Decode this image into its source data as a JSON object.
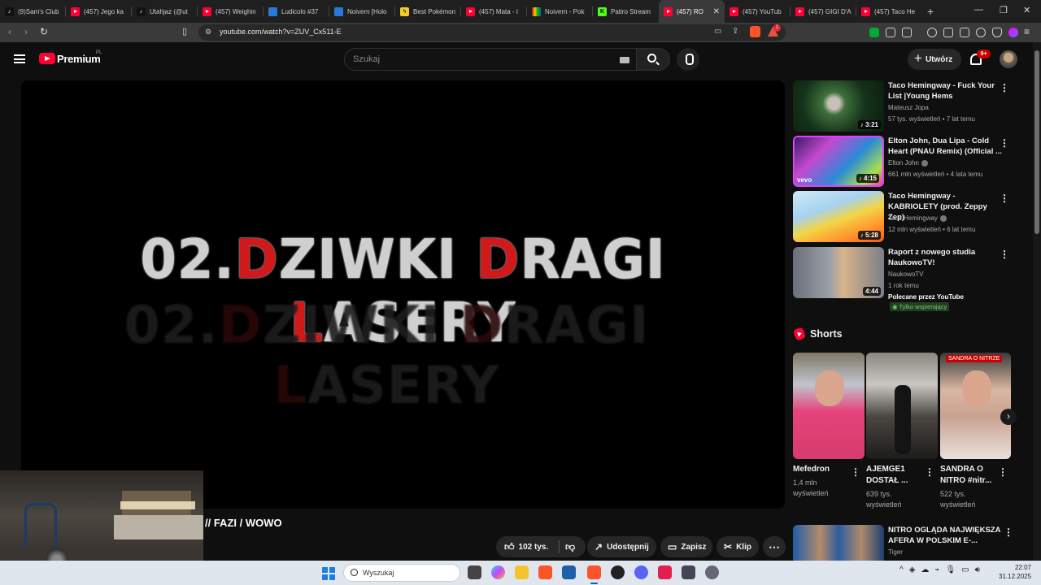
{
  "browser": {
    "tabs": [
      {
        "label": "(9)Sam's Club",
        "icon": "tiktok"
      },
      {
        "label": "(457) Jego ka",
        "icon": "youtube"
      },
      {
        "label": "Utahjaz (@ut",
        "icon": "tiktok"
      },
      {
        "label": "(457) Weighin",
        "icon": "youtube"
      },
      {
        "label": "Ludicolo #37",
        "icon": "pokemon"
      },
      {
        "label": "Noivern [Holo",
        "icon": "blue"
      },
      {
        "label": "Best Pokémon",
        "icon": "pikachu"
      },
      {
        "label": "(457) Mata - I",
        "icon": "youtube"
      },
      {
        "label": "Noivern - Pok",
        "icon": "multicolor"
      },
      {
        "label": "Patiro Stream",
        "icon": "kick"
      },
      {
        "label": "(457) RO",
        "icon": "youtube",
        "active": true
      },
      {
        "label": "(457) YouTub",
        "icon": "youtube"
      },
      {
        "label": "(457) GIGI D'A",
        "icon": "youtube"
      },
      {
        "label": "(457) Taco He",
        "icon": "youtube"
      }
    ],
    "url": "youtube.com/watch?v=ZUV_Cx511-E",
    "extension_badge": "1"
  },
  "youtube": {
    "logo_text": "Premium",
    "logo_country": "PL",
    "search_placeholder": "Szukaj",
    "create_label": "Utwórz",
    "notifications_badge": "9+",
    "video": {
      "frame_text_parts": [
        "02.",
        "D",
        "ZIWKI ",
        "D",
        "RAGI ",
        "L",
        "ASERY"
      ],
      "title": "// FAZI / WOWO",
      "likes": "102 tys.",
      "share_label": "Udostępnij",
      "save_label": "Zapisz",
      "clip_label": "Klip"
    },
    "recommendations": [
      {
        "title": "Taco Hemingway - Fuck Your List |Young Hems",
        "channel": "Mateusz Jopa",
        "verified": false,
        "meta": "57 tys. wyświetleń • 7 lat temu",
        "duration": "3:21"
      },
      {
        "title": "Elton John, Dua Lipa - Cold Heart (PNAU Remix) (Official ...",
        "channel": "Elton John",
        "verified": true,
        "meta": "661 mln wyświetleń • 4 lata temu",
        "duration": "4:15",
        "thumb_label": "vevo"
      },
      {
        "title": "Taco Hemingway - KABRIOLETY (prod. Zeppy Zep)",
        "channel": "Taco Hemingway",
        "verified": true,
        "meta": "12 mln wyświetleń • 6 lat temu",
        "duration": "5:28"
      },
      {
        "title": "Raport z nowego studia NaukowoTV!",
        "channel": "NaukowoTV",
        "verified": false,
        "meta": "1 rok temu",
        "duration": "4:44",
        "recommended": "Polecane przez YouTube",
        "members": "Tylko wspierający"
      }
    ],
    "shorts_label": "Shorts",
    "shorts": [
      {
        "title": "Mefedron",
        "views": "1,4 mln wyświetleń"
      },
      {
        "title": "AJEMGE1 DOSTAŁ ...",
        "views": "639 tys. wyświetleń"
      },
      {
        "title": "SANDRA O NITRO #nitr...",
        "views": "522 tys. wyświetleń",
        "badge": "SANDRA O NITRZE"
      }
    ],
    "rec5": {
      "title": "NITRO OGLĄDA NAJWIĘKSZA AFERA W POLSKIM E-...",
      "channel": "Tiger"
    }
  },
  "taskbar": {
    "search_placeholder": "Wyszukaj",
    "time": "22:07",
    "date": "31.12.2025"
  }
}
